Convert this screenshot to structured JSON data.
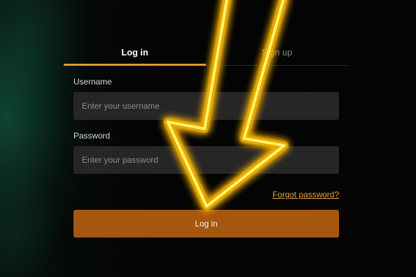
{
  "tabs": [
    {
      "label": "Log in",
      "active": true
    },
    {
      "label": "Sign up",
      "active": false
    }
  ],
  "username": {
    "label": "Username",
    "placeholder": "Enter your username",
    "value": ""
  },
  "password": {
    "label": "Password",
    "placeholder": "Enter your password",
    "value": ""
  },
  "forgot_password": "Forgot password?",
  "submit_label": "Log in",
  "colors": {
    "accent": "#e39a2a",
    "button": "#a5560f",
    "arrow_glow": "#ffd21a"
  },
  "overlay_icon": "glowing-arrow-icon"
}
